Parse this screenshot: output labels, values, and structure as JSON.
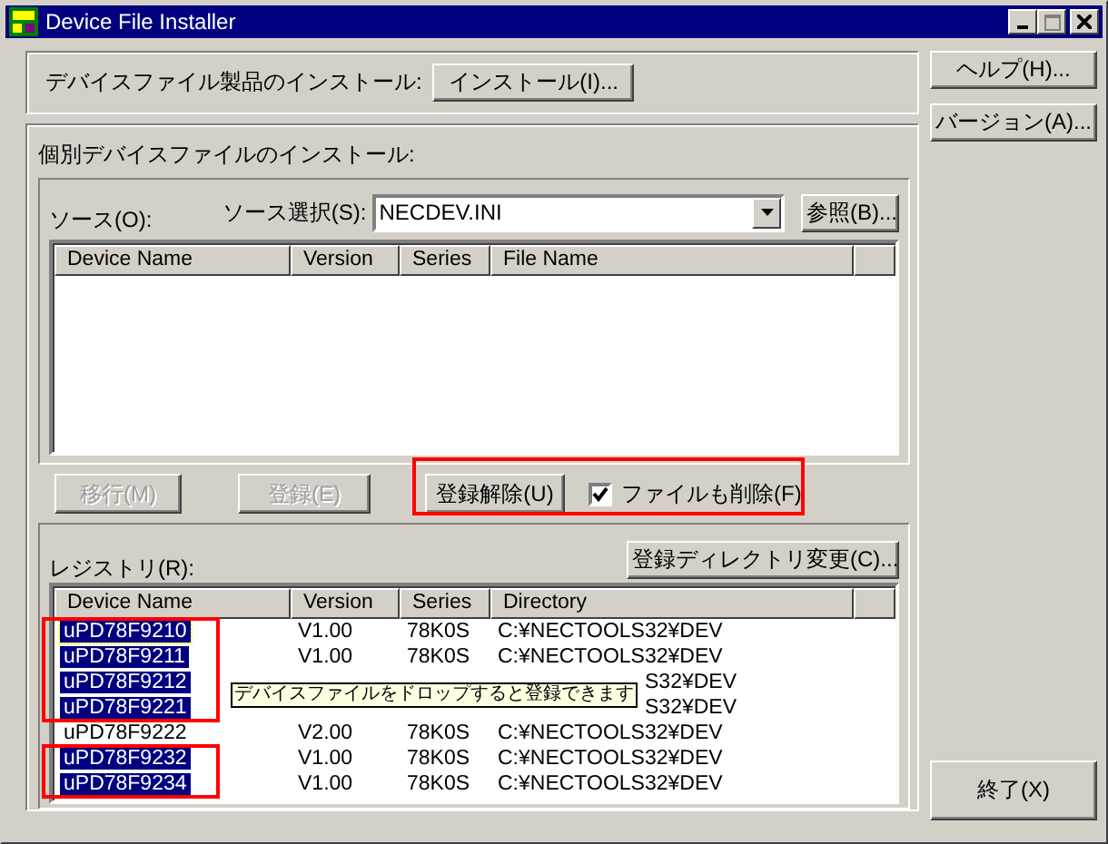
{
  "window": {
    "title": "Device File Installer"
  },
  "product_install": {
    "label": "デバイスファイル製品のインストール:",
    "button": "インストール(I)..."
  },
  "individual": {
    "label": "個別デバイスファイルのインストール:",
    "source_label": "ソース(O):",
    "source_select_label": "ソース選択(S):",
    "source_value": "NECDEV.INI",
    "browse_button": "参照(B)...",
    "source_columns": [
      "Device Name",
      "Version",
      "Series",
      "File Name"
    ],
    "actions": [
      {
        "label": "移行(M)",
        "disabled": true
      },
      {
        "label": "登録(E)",
        "disabled": true
      },
      {
        "label": "登録解除(U)",
        "disabled": false
      }
    ],
    "delete_files": {
      "label": "ファイルも削除(F)",
      "checked": true
    },
    "registry_label": "レジストリ(R):",
    "change_dir_button": "登録ディレクトリ変更(C)...",
    "registry_columns": [
      "Device Name",
      "Version",
      "Series",
      "Directory"
    ],
    "registry_rows": [
      {
        "device": "uPD78F9210",
        "version": "V1.00",
        "series": "78K0S",
        "directory": "C:¥NECTOOLS32¥DEV",
        "selected": true
      },
      {
        "device": "uPD78F9211",
        "version": "V1.00",
        "series": "78K0S",
        "directory": "C:¥NECTOOLS32¥DEV",
        "selected": true
      },
      {
        "device": "uPD78F9212",
        "directory": "S32¥DEV",
        "selected": true
      },
      {
        "device": "uPD78F9221",
        "directory": "S32¥DEV",
        "selected": true
      },
      {
        "device": "uPD78F9222",
        "version": "V2.00",
        "series": "78K0S",
        "directory": "C:¥NECTOOLS32¥DEV",
        "selected": false
      },
      {
        "device": "uPD78F9232",
        "version": "V1.00",
        "series": "78K0S",
        "directory": "C:¥NECTOOLS32¥DEV",
        "selected": true
      },
      {
        "device": "uPD78F9234",
        "version": "V1.00",
        "series": "78K0S",
        "directory": "C:¥NECTOOLS32¥DEV",
        "selected": true
      }
    ],
    "tooltip": "デバイスファイルをドロップすると登録できます"
  },
  "side_buttons": [
    "ヘルプ(H)...",
    "バージョン(A)..."
  ],
  "exit_button": "終了(X)"
}
